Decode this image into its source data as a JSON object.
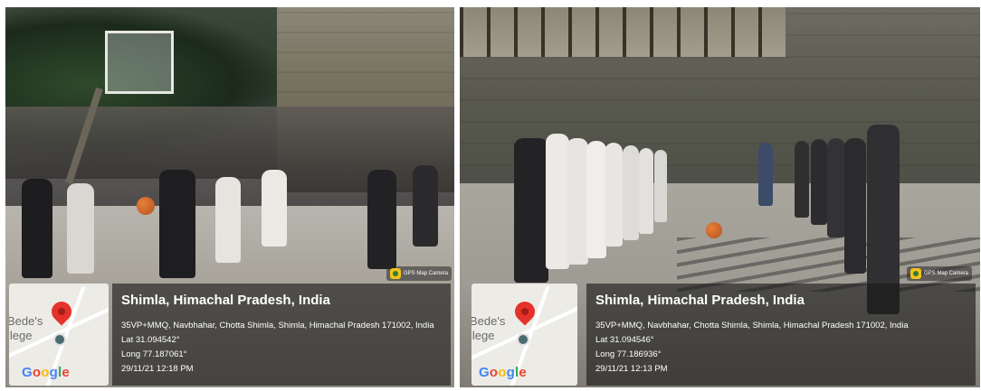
{
  "left": {
    "watermark": "GPS Map Camera",
    "map": {
      "text_top": "Bede's",
      "text_bottom": "llege",
      "logo": [
        "G",
        "o",
        "o",
        "g",
        "l",
        "e"
      ]
    },
    "info": {
      "title": "Shimla, Himachal Pradesh, India",
      "address": "35VP+MMQ, Navbhahar, Chotta Shimla, Shimla, Himachal Pradesh 171002, India",
      "lat": "Lat 31.094542°",
      "long": "Long 77.187061°",
      "datetime": "29/11/21 12:18 PM"
    }
  },
  "right": {
    "watermark": "GPS Map Camera",
    "map": {
      "text_top": "Bede's",
      "text_bottom": "llege",
      "logo": [
        "G",
        "o",
        "o",
        "g",
        "l",
        "e"
      ]
    },
    "info": {
      "title": "Shimla, Himachal Pradesh, India",
      "address": "35VP+MMQ, Navbhahar, Chotta Shimla, Shimla, Himachal Pradesh 171002, India",
      "lat": "Lat 31.094546°",
      "long": "Long 77.186936°",
      "datetime": "29/11/21 12:13 PM"
    }
  },
  "colors": {
    "pin": "#e5322b",
    "panel": "#191919",
    "watermark_icon": "#f2c318"
  },
  "icons": [
    "map-pin-icon",
    "location-dot-icon",
    "camera-icon"
  ]
}
